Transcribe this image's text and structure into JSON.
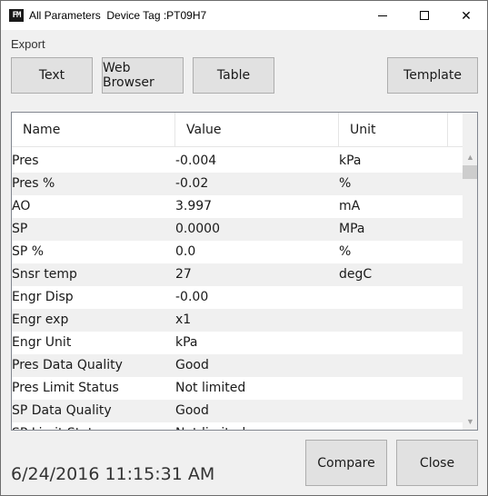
{
  "window": {
    "app_icon": "FM",
    "title": "All Parameters  Device Tag :PT09H7",
    "controls": {
      "minimize": "minimize-icon",
      "maximize": "maximize-icon",
      "close": "✕"
    }
  },
  "export": {
    "label": "Export",
    "buttons": {
      "text": "Text",
      "web_browser": "Web Browser",
      "table": "Table",
      "template": "Template"
    }
  },
  "grid": {
    "columns": [
      "Name",
      "Value",
      "Unit"
    ],
    "rows": [
      {
        "name": "Pres",
        "value": "-0.004",
        "unit": "kPa"
      },
      {
        "name": "Pres %",
        "value": "-0.02",
        "unit": "%"
      },
      {
        "name": "AO",
        "value": "3.997",
        "unit": "mA"
      },
      {
        "name": "SP",
        "value": "0.0000",
        "unit": "MPa"
      },
      {
        "name": "SP %",
        "value": "0.0",
        "unit": "%"
      },
      {
        "name": "Snsr temp",
        "value": "27",
        "unit": "degC"
      },
      {
        "name": "Engr Disp",
        "value": "-0.00",
        "unit": ""
      },
      {
        "name": "Engr exp",
        "value": "x1",
        "unit": ""
      },
      {
        "name": "Engr Unit",
        "value": "kPa",
        "unit": ""
      },
      {
        "name": "Pres Data Quality",
        "value": "Good",
        "unit": ""
      },
      {
        "name": "Pres Limit Status",
        "value": "Not limited",
        "unit": ""
      },
      {
        "name": "SP Data Quality",
        "value": "Good",
        "unit": ""
      },
      {
        "name": "SP Limit Status",
        "value": "Not limited",
        "unit": ""
      }
    ]
  },
  "footer": {
    "timestamp": "6/24/2016 11:15:31 AM",
    "compare": "Compare",
    "close": "Close"
  }
}
